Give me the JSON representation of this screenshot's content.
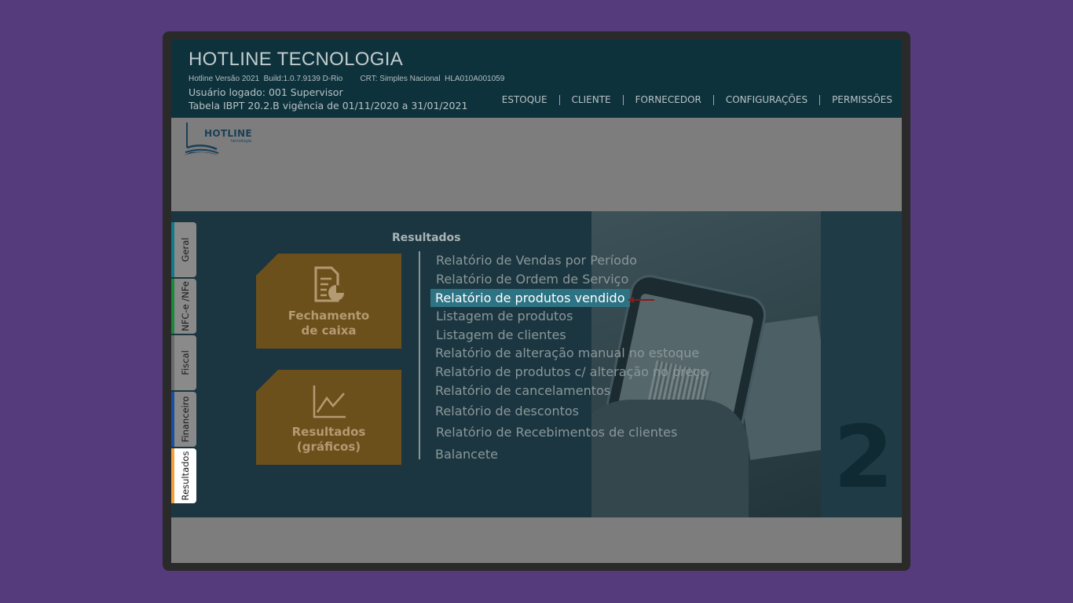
{
  "header": {
    "title": "HOTLINE TECNOLOGIA",
    "version_line": "Hotline Versão 2021  Build:1.0.7.9139 D-Rio        CRT: Simples Nacional  HLA010A001059",
    "user_line": "Usuário logado: 001 Supervisor",
    "ibpt_line": "Tabela IBPT 20.2.B vigência de 01/11/2020 a 31/01/2021",
    "nav": [
      "ESTOQUE",
      "CLIENTE",
      "FORNECEDOR",
      "CONFIGURAÇÕES",
      "PERMISSÕES"
    ]
  },
  "logo": {
    "text": "HOTLINE",
    "sub": "tecnologia",
    "color": "#1a3f57"
  },
  "tabs": [
    {
      "label": "Geral",
      "accent": "#0e7a8a"
    },
    {
      "label": "NFC-e /NFe",
      "accent": "#1a8a3a"
    },
    {
      "label": "Fiscal",
      "accent": "#6c6c6c"
    },
    {
      "label": "Financeiro",
      "accent": "#1a4fa0"
    },
    {
      "label": "Resultados",
      "accent": "#f2a23a",
      "active": true
    }
  ],
  "main": {
    "section_title": "Resultados",
    "cards": [
      {
        "label_line1": "Fechamento",
        "label_line2": "de caixa",
        "icon": "report-document-icon"
      },
      {
        "label_line1": "Resultados",
        "label_line2": "(gráficos)",
        "icon": "line-chart-icon"
      }
    ],
    "reports": [
      "Relatório  de Vendas por Período",
      "Relatório  de Ordem de Serviço",
      "Relatório de produtos vendido",
      "Listagem de produtos",
      "Listagem de clientes",
      "Relatório de alteração manual no estoque",
      "Relatório de produtos c/ alteração no preço",
      "Relatório de cancelamentos",
      "Relatório de descontos",
      "Relatório  de Recebimentos de clientes",
      "Balancete"
    ],
    "selected_report_index": 2,
    "big_digit": "2"
  },
  "colors": {
    "header_bg": "#0d323c",
    "main_bg": "#1b3640",
    "card_bg": "#6c501c",
    "selected_bg": "#2d7384",
    "arrow": "#8b1a1a",
    "page_bg": "#553b7c"
  }
}
